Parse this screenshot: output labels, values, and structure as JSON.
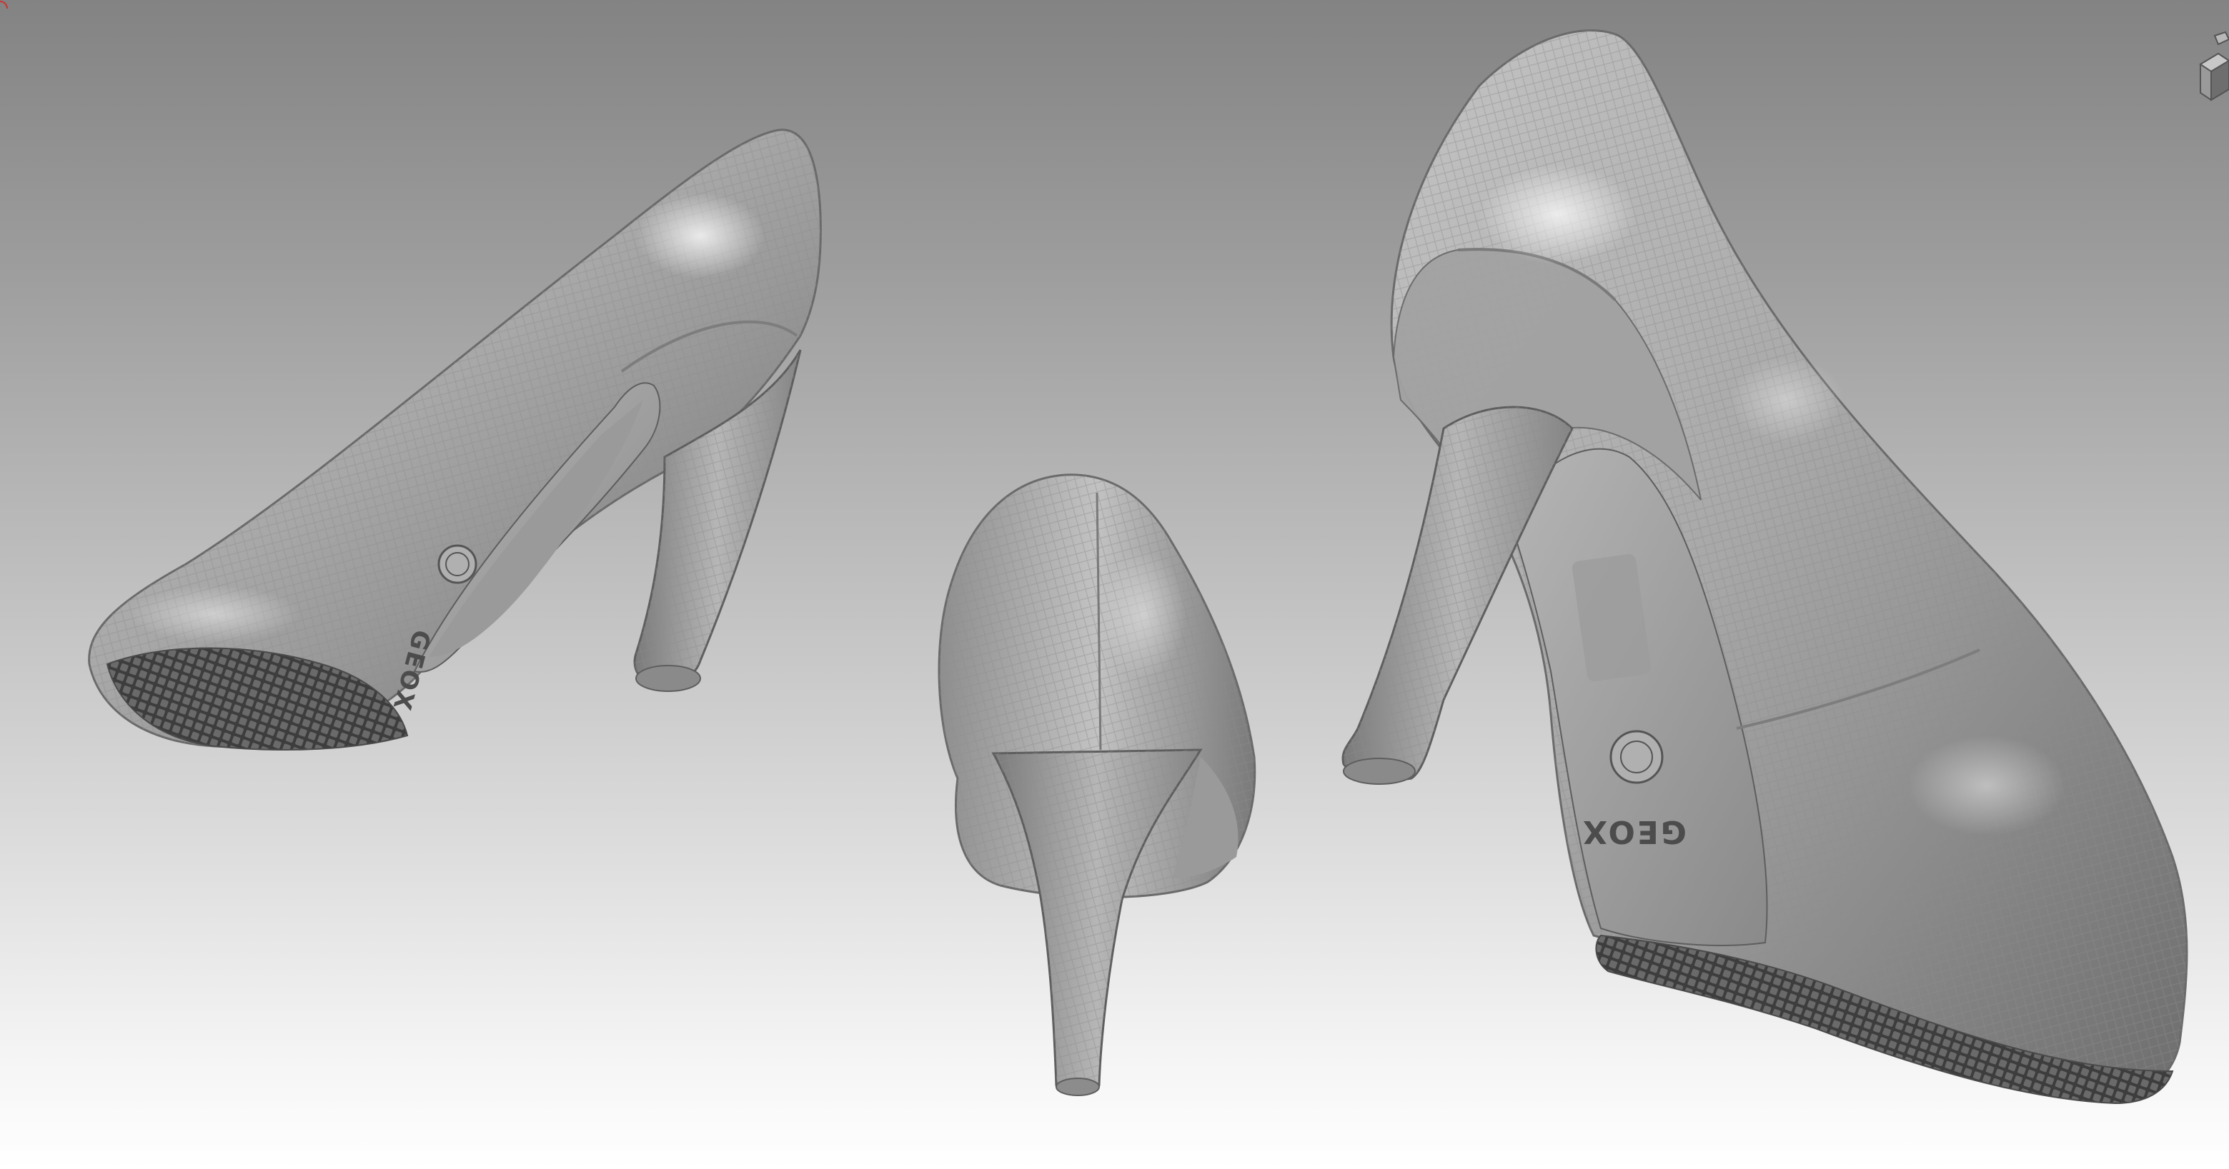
{
  "viewport": {
    "background_top": "#838383",
    "background_bottom": "#ffffff",
    "mesh_color": "#a6a6a6",
    "mesh_shadow": "#5a5a5a",
    "mesh_highlight": "#e6e6e6"
  },
  "gizmo": {
    "icon": "navigation-cube-icon"
  },
  "shoes": [
    {
      "view": "side",
      "brand_text": "GEOX"
    },
    {
      "view": "back"
    },
    {
      "view": "three-quarter",
      "brand_text": "GEOX"
    }
  ]
}
